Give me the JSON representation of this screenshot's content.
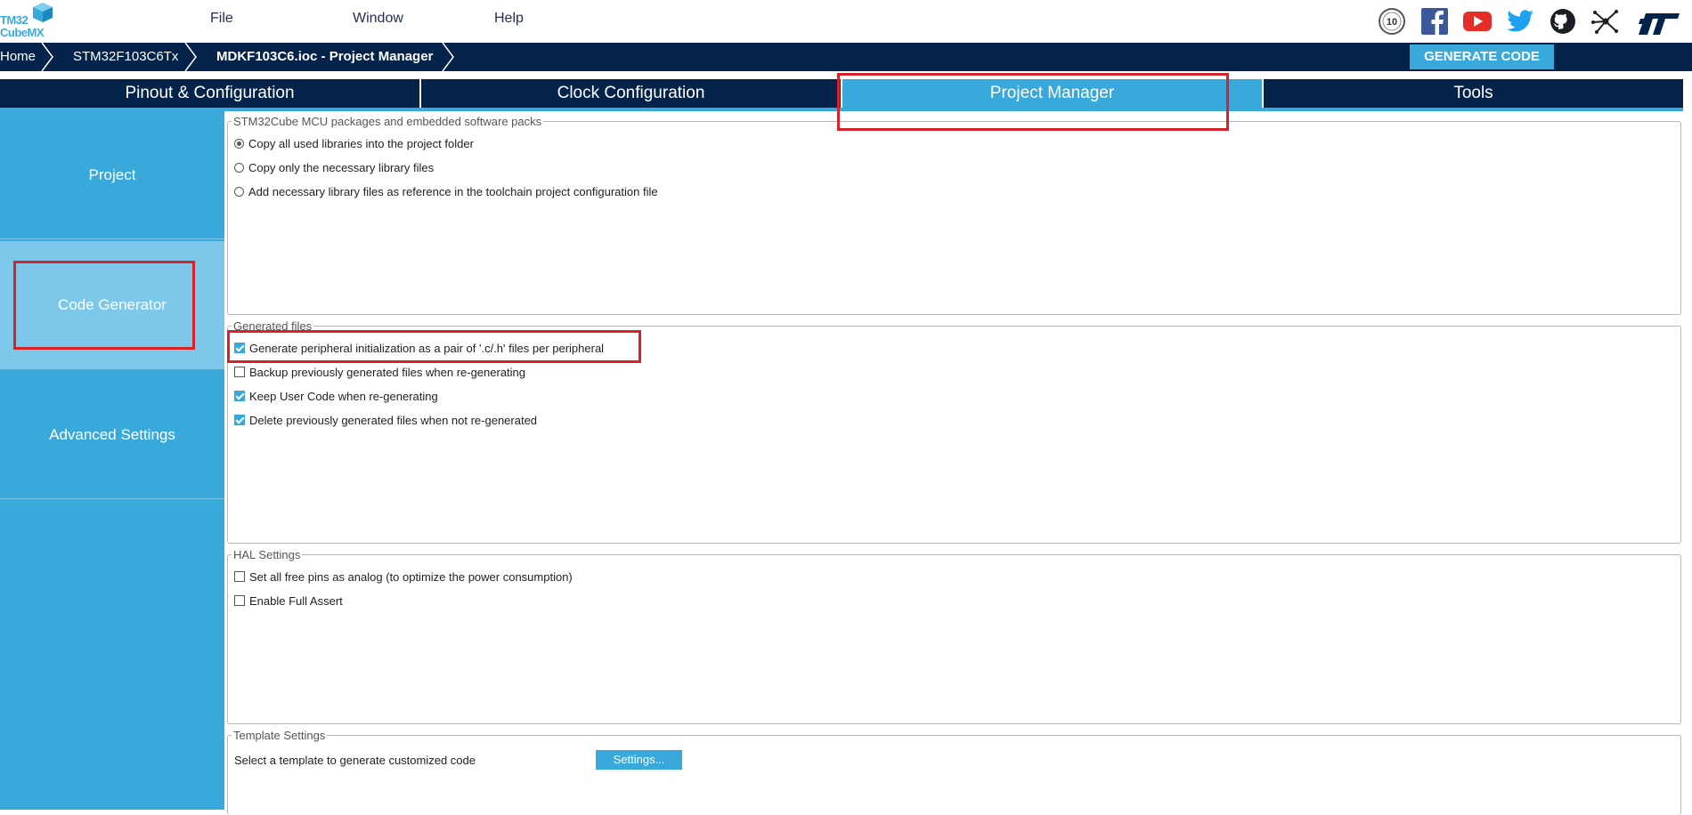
{
  "app": {
    "logo_line1": "TM32",
    "logo_line2": "CubeMX"
  },
  "menu": [
    {
      "label": "File"
    },
    {
      "label": "Window"
    },
    {
      "label": "Help"
    }
  ],
  "top_icons": [
    "anniversary-10-icon",
    "facebook-icon",
    "youtube-icon",
    "twitter-icon",
    "github-icon",
    "network-icon",
    "st-logo-icon"
  ],
  "breadcrumb": {
    "home": "Home",
    "mcu": "STM32F103C6Tx",
    "project": "MDKF103C6.ioc - Project Manager"
  },
  "generate_code_label": "GENERATE CODE",
  "tabs": [
    {
      "label": "Pinout & Configuration",
      "active": false
    },
    {
      "label": "Clock Configuration",
      "active": false
    },
    {
      "label": "Project Manager",
      "active": true
    },
    {
      "label": "Tools",
      "active": false
    }
  ],
  "sidebar": {
    "items": [
      {
        "label": "Project",
        "active": false
      },
      {
        "label": "Code Generator",
        "active": true
      },
      {
        "label": "Advanced Settings",
        "active": false
      }
    ]
  },
  "packages": {
    "title": "STM32Cube MCU packages and embedded software packs",
    "options": [
      {
        "label": "Copy all used libraries into the project folder",
        "selected": true
      },
      {
        "label": "Copy only the necessary library files",
        "selected": false
      },
      {
        "label": "Add necessary library files as reference in the toolchain project configuration file",
        "selected": false
      }
    ]
  },
  "generated_files": {
    "title": "Generated files",
    "options": [
      {
        "label": "Generate peripheral initialization as a pair of '.c/.h' files per peripheral",
        "checked": true
      },
      {
        "label": "Backup previously generated files when re-generating",
        "checked": false
      },
      {
        "label": "Keep User Code when re-generating",
        "checked": true
      },
      {
        "label": "Delete previously generated files when not re-generated",
        "checked": true
      }
    ]
  },
  "hal_settings": {
    "title": "HAL Settings",
    "options": [
      {
        "label": "Set all free pins as analog (to optimize the power consumption)",
        "checked": false
      },
      {
        "label": "Enable Full Assert",
        "checked": false
      }
    ]
  },
  "template_settings": {
    "title": "Template Settings",
    "label": "Select a template to generate customized code",
    "button": "Settings..."
  },
  "colors": {
    "accent": "#39a9dc",
    "dark_navy": "#03234b",
    "highlight_red": "#d8222a",
    "sidebar_active": "#7cc7ea"
  }
}
